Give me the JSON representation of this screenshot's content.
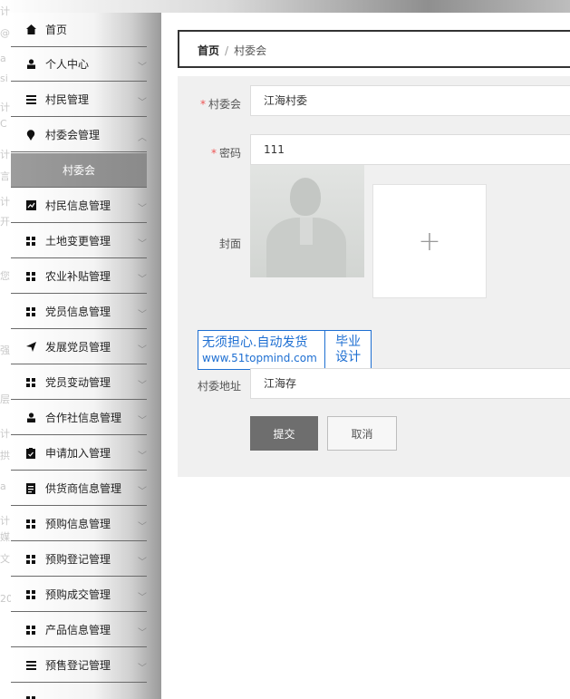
{
  "sidebar": {
    "items": [
      {
        "icon": "home-icon",
        "label": "首页"
      },
      {
        "icon": "user-icon",
        "label": "个人中心"
      },
      {
        "icon": "list-icon",
        "label": "村民管理"
      },
      {
        "icon": "pin-icon",
        "label": "村委会管理"
      },
      {
        "icon": "",
        "label": "村委会"
      },
      {
        "icon": "chart-icon",
        "label": "村民信息管理"
      },
      {
        "icon": "grid-icon",
        "label": "土地变更管理"
      },
      {
        "icon": "grid-icon",
        "label": "农业补贴管理"
      },
      {
        "icon": "grid-icon",
        "label": "党员信息管理"
      },
      {
        "icon": "send-icon",
        "label": "发展党员管理"
      },
      {
        "icon": "grid-icon",
        "label": "党员变动管理"
      },
      {
        "icon": "user-icon",
        "label": "合作社信息管理"
      },
      {
        "icon": "clipboard-icon",
        "label": "申请加入管理"
      },
      {
        "icon": "doc-icon",
        "label": "供货商信息管理"
      },
      {
        "icon": "grid-icon",
        "label": "预购信息管理"
      },
      {
        "icon": "grid-icon",
        "label": "预购登记管理"
      },
      {
        "icon": "grid-icon",
        "label": "预购成交管理"
      },
      {
        "icon": "grid-icon",
        "label": "产品信息管理"
      },
      {
        "icon": "list-icon",
        "label": "预售登记管理"
      }
    ]
  },
  "breadcrumb": {
    "home": "首页",
    "separator": "/",
    "current": "村委会"
  },
  "form": {
    "cunweihui_label": "村委会",
    "cunweihui_value": "江海村委",
    "password_label": "密码",
    "password_value": "111",
    "cover_label": "封面",
    "address_label": "村委地址",
    "address_value": "江海存",
    "required_mark": "*",
    "upload_plus": "+",
    "submit": "提交",
    "cancel": "取消"
  },
  "watermark": {
    "line1": "无须担心.自动发货",
    "line2": "www.51topmind.com",
    "right1": "毕业",
    "right2": "设计"
  },
  "ghost": [
    "计",
    "@",
    "a",
    "si",
    "计",
    "C",
    "计",
    "言",
    "计",
    "开",
    "您",
    "强",
    "层",
    "计",
    "拱",
    "a",
    "计",
    "媒",
    "文",
    "20"
  ],
  "colors": {
    "active_bg": "#8f8f8f",
    "required": "#ee5555",
    "watermark": "#1e6fd2",
    "submit_bg": "#6e6e6e"
  }
}
